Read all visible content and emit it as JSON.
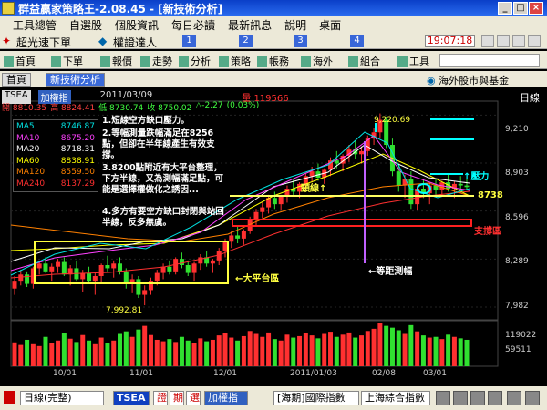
{
  "window": {
    "title": "群益贏家策略王-2.08.45 - [新技術分析]",
    "min": "_",
    "max": "□",
    "close": "×"
  },
  "menu": {
    "items": [
      "工具總管",
      "自選股",
      "個股資訊",
      "每日必讀",
      "最新訊息",
      "說明",
      "桌面"
    ]
  },
  "toolbar1": {
    "left_label": "超光速下單",
    "mid_label": "權證達人",
    "nums": [
      "1",
      "2",
      "3",
      "4",
      "5",
      "6"
    ],
    "clock": "19:07:18"
  },
  "toolbar2": {
    "items": [
      "首頁",
      "下單",
      "報價",
      "走勢",
      "分析",
      "策略",
      "帳務",
      "海外",
      "組合",
      "工具"
    ]
  },
  "tabs": {
    "items": [
      "首頁",
      "新技術分析"
    ],
    "right_label": "海外股市與基金"
  },
  "chart_header": {
    "symbol": "TSEA",
    "name": "加權指",
    "date": "2011/03/09",
    "volume_label": "量 119566",
    "k_line": "日線",
    "open": "開 8810.35",
    "high": "高 8824.41",
    "low": "低 8730.74",
    "close": "收 8750.02",
    "change": "△-2.27",
    "pct": "(0.03%)"
  },
  "ma_legend": [
    {
      "name": "MA5",
      "val": "8746.87",
      "color": "#00e0e0"
    },
    {
      "name": "MA10",
      "val": "8675.20",
      "color": "#ff40ff"
    },
    {
      "name": "MA20",
      "val": "8718.31",
      "color": "#ffffff"
    },
    {
      "name": "MA60",
      "val": "8838.91",
      "color": "#ffff00"
    },
    {
      "name": "MA120",
      "val": "8559.50",
      "color": "#ff8000"
    },
    {
      "name": "MA240",
      "val": "8137.29",
      "color": "#ff3030"
    }
  ],
  "notes": [
    "1.短線空方缺口壓力。",
    "2.等幅測量跌幅滿足在8256點，但卻在半年線產生有效支撐。",
    "3.8200點附近有大平台整理，下方半線，又為測幅滿足點，可能是選擇權做化之誘因...",
    "4.多方有要空方缺口封閉與站回半線，反多無虞。"
  ],
  "annotations": {
    "neckline": "頸線↑",
    "big_platform": "←大平台區",
    "equal_measure": "←等距測幅",
    "pressure": "↑壓力",
    "support": "支撐區",
    "level_8738": "8738",
    "high_label": "9,220.69",
    "low_label": "7,992.81"
  },
  "price_axis": [
    "9,210",
    "8,903",
    "8,596",
    "8,289",
    "7,982"
  ],
  "volume_axis": [
    "119022",
    "59511"
  ],
  "time_axis": [
    "10/01",
    "11/01",
    "12/01",
    "2011/01/03",
    "02/08",
    "03/01"
  ],
  "status": {
    "period": "日線(完整)",
    "symbol": "TSEA",
    "btn1": "證",
    "btn2": "期",
    "btn3": "選",
    "name": "加權指",
    "index1": "[海期]國際指數",
    "index2": "上海綜合指數"
  },
  "chart_data": {
    "type": "candlestick",
    "ylim": [
      7900,
      9300
    ],
    "vol_max": 119022,
    "ohlc": [
      [
        8100,
        8180,
        8060,
        8150
      ],
      [
        8150,
        8220,
        8120,
        8190
      ],
      [
        8190,
        8210,
        8110,
        8130
      ],
      [
        8130,
        8240,
        8100,
        8230
      ],
      [
        8230,
        8280,
        8190,
        8260
      ],
      [
        8260,
        8300,
        8200,
        8210
      ],
      [
        8210,
        8260,
        8150,
        8240
      ],
      [
        8240,
        8290,
        8200,
        8270
      ],
      [
        8270,
        8300,
        8180,
        8190
      ],
      [
        8190,
        8250,
        8120,
        8230
      ],
      [
        8230,
        8280,
        8150,
        8160
      ],
      [
        8160,
        8220,
        8080,
        8200
      ],
      [
        8200,
        8240,
        8130,
        8150
      ],
      [
        8150,
        8200,
        8060,
        8180
      ],
      [
        8180,
        8260,
        8140,
        8250
      ],
      [
        8250,
        8310,
        8210,
        8230
      ],
      [
        8230,
        8280,
        8170,
        8260
      ],
      [
        8260,
        8300,
        8190,
        8210
      ],
      [
        8210,
        8230,
        8100,
        8130
      ],
      [
        8130,
        8190,
        8070,
        8160
      ],
      [
        8160,
        8180,
        8040,
        8060
      ],
      [
        8060,
        8120,
        7993,
        8090
      ],
      [
        8090,
        8170,
        8060,
        8150
      ],
      [
        8150,
        8220,
        8120,
        8200
      ],
      [
        8200,
        8260,
        8160,
        8240
      ],
      [
        8240,
        8280,
        8190,
        8210
      ],
      [
        8210,
        8300,
        8190,
        8290
      ],
      [
        8290,
        8330,
        8230,
        8250
      ],
      [
        8250,
        8280,
        8180,
        8200
      ],
      [
        8200,
        8270,
        8150,
        8260
      ],
      [
        8260,
        8320,
        8220,
        8300
      ],
      [
        8300,
        8340,
        8240,
        8260
      ],
      [
        8260,
        8290,
        8200,
        8280
      ],
      [
        8280,
        8360,
        8250,
        8340
      ],
      [
        8340,
        8420,
        8300,
        8400
      ],
      [
        8400,
        8470,
        8360,
        8440
      ],
      [
        8440,
        8500,
        8390,
        8420
      ],
      [
        8420,
        8480,
        8380,
        8470
      ],
      [
        8470,
        8560,
        8450,
        8540
      ],
      [
        8540,
        8610,
        8500,
        8590
      ],
      [
        8590,
        8650,
        8550,
        8620
      ],
      [
        8620,
        8700,
        8580,
        8680
      ],
      [
        8680,
        8720,
        8610,
        8640
      ],
      [
        8640,
        8700,
        8600,
        8690
      ],
      [
        8690,
        8760,
        8650,
        8740
      ],
      [
        8740,
        8800,
        8700,
        8720
      ],
      [
        8720,
        8780,
        8680,
        8770
      ],
      [
        8770,
        8840,
        8730,
        8820
      ],
      [
        8820,
        8880,
        8780,
        8850
      ],
      [
        8850,
        8900,
        8790,
        8810
      ],
      [
        8810,
        8870,
        8770,
        8860
      ],
      [
        8860,
        8940,
        8820,
        8920
      ],
      [
        8920,
        8980,
        8870,
        8900
      ],
      [
        8900,
        8960,
        8850,
        8950
      ],
      [
        8950,
        9020,
        8910,
        8990
      ],
      [
        8990,
        9050,
        8930,
        8960
      ],
      [
        8960,
        9010,
        8900,
        8980
      ],
      [
        8980,
        9080,
        8950,
        9060
      ],
      [
        9060,
        9130,
        9020,
        9100
      ],
      [
        9100,
        9221,
        9060,
        9180
      ],
      [
        9180,
        9200,
        9000,
        9020
      ],
      [
        9020,
        9060,
        8820,
        8850
      ],
      [
        8850,
        8900,
        8720,
        8760
      ],
      [
        8760,
        8830,
        8680,
        8800
      ],
      [
        8800,
        8850,
        8610,
        8640
      ],
      [
        8640,
        8760,
        8600,
        8740
      ],
      [
        8740,
        8800,
        8680,
        8710
      ],
      [
        8710,
        8780,
        8640,
        8760
      ],
      [
        8760,
        8800,
        8700,
        8730
      ],
      [
        8730,
        8790,
        8690,
        8780
      ],
      [
        8780,
        8830,
        8720,
        8740
      ],
      [
        8740,
        8790,
        8680,
        8770
      ],
      [
        8770,
        8820,
        8730,
        8760
      ],
      [
        8760,
        8824,
        8730,
        8750
      ]
    ],
    "volumes": [
      65,
      58,
      72,
      60,
      55,
      80,
      62,
      70,
      90,
      75,
      66,
      85,
      70,
      60,
      78,
      62,
      70,
      88,
      95,
      80,
      100,
      110,
      85,
      72,
      68,
      74,
      66,
      80,
      70,
      62,
      76,
      68,
      72,
      84,
      90,
      78,
      70,
      82,
      96,
      88,
      80,
      92,
      74,
      70,
      86,
      78,
      82,
      90,
      84,
      76,
      88,
      94,
      80,
      86,
      92,
      78,
      84,
      96,
      102,
      119,
      110,
      105,
      98,
      88,
      112,
      95,
      84,
      78,
      80,
      74,
      86,
      80,
      76,
      72
    ]
  }
}
